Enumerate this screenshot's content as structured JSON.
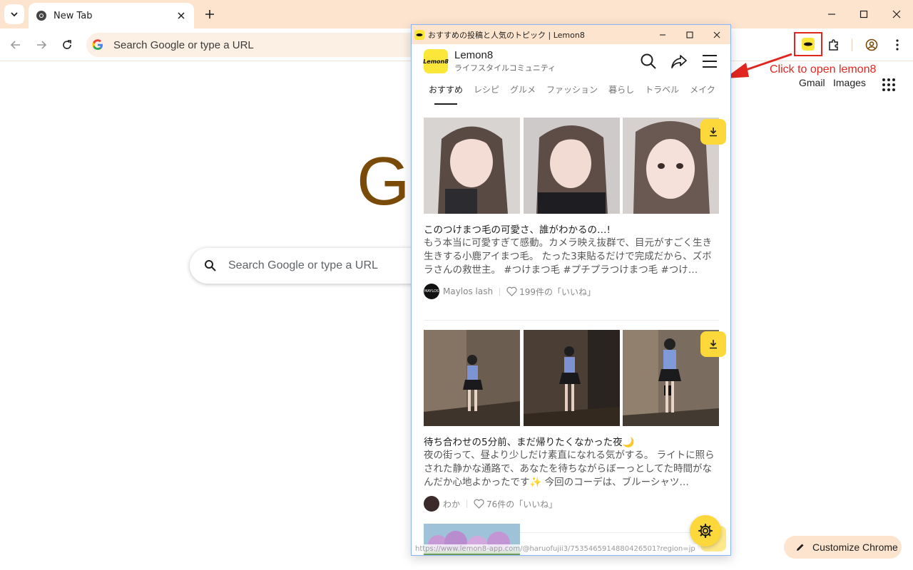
{
  "browser": {
    "tab_title": "New Tab",
    "omnibox_placeholder": "Search Google or type a URL"
  },
  "ntp": {
    "gmail": "Gmail",
    "images": "Images",
    "logo_text": "G",
    "search_placeholder": "Search Google or type a URL",
    "customize_label": "Customize Chrome"
  },
  "annotation": {
    "text": "Click to open lemon8",
    "color": "#e0261f"
  },
  "popup": {
    "window_title": "おすすめの投稿と人気のトピック | Lemon8",
    "brand_name": "Lemon8",
    "brand_tagline": "ライフスタイルコミュニティ",
    "logo_text": "Lemon8",
    "categories": [
      {
        "label": "おすすめ",
        "active": true
      },
      {
        "label": "レシピ",
        "active": false
      },
      {
        "label": "グルメ",
        "active": false
      },
      {
        "label": "ファッション",
        "active": false
      },
      {
        "label": "暮らし",
        "active": false
      },
      {
        "label": "トラベル",
        "active": false
      },
      {
        "label": "メイク",
        "active": false
      }
    ],
    "posts": [
      {
        "title": "このつけまつ毛の可愛さ、誰がわかるの…!",
        "body": "もう本当に可愛すぎて感動。カメラ映え抜群で、目元がすごく生き生きする小鹿アイまつ毛。 たった3束貼るだけで完成だから、ズボラさんの救世主。 #つけまつ毛 #プチプラつけまつ毛 #つけ…",
        "author": "Maylos lash",
        "avatar_text": "MAYLOS",
        "likes": "199件の「いいね」"
      },
      {
        "title": "待ち合わせの5分前、まだ帰りたくなかった夜🌙",
        "body": "夜の街って、昼より少しだけ素直になれる気がする。 ライトに照らされた静かな通路で、あなたを待ちながらぼーっとしてた時間がなんだか心地よかったです✨ 今回のコーデは、ブルーシャツ…",
        "author": "わか",
        "avatar_text": "",
        "likes": "76件の「いいね」"
      }
    ],
    "status_url": "https://www.lemon8-app.com/@haruofujii3/7535465914880426501?region=jp"
  },
  "colors": {
    "chrome_frame": "#fde4cf",
    "lemon_yellow": "#fdd83a",
    "google_logo": "#7a4a08"
  }
}
